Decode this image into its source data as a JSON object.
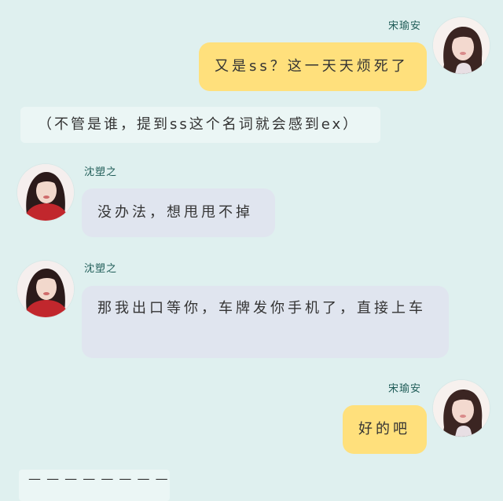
{
  "messages": [
    {
      "name": "宋瑜安",
      "text": "又是ss？这一天天烦死了"
    },
    {
      "text": "（不管是谁，提到ss这个名词就会感到ex）"
    },
    {
      "name": "沈塑之",
      "text": "没办法，想甩甩不掉"
    },
    {
      "name": "沈塑之",
      "text": "那我出口等你，车牌发你手机了，直接上车"
    },
    {
      "name": "宋瑜安",
      "text": "好的吧"
    }
  ],
  "divider": "— — — — — — — — — — — — —",
  "colors": {
    "background": "#dff0ef",
    "self_bubble": "#ffe07c",
    "other_bubble": "#e0e5ef",
    "narration_box": "#ebf6f5",
    "name_text": "#1f5c57"
  }
}
